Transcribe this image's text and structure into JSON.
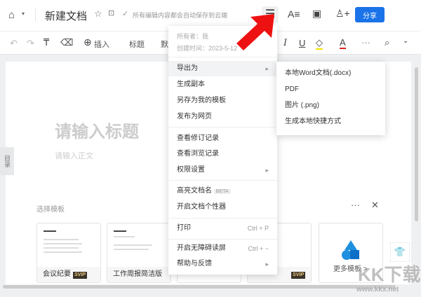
{
  "header": {
    "title": "新建文档",
    "save_status": "所有编辑内容都会自动保存到云端",
    "share": "分享"
  },
  "toolbar": {
    "insert": "插入",
    "heading": "标题",
    "font_partial": "默"
  },
  "doc": {
    "title_placeholder": "请输入标题",
    "body_placeholder": "请输入正文",
    "toc": "目录"
  },
  "templates": {
    "label": "选择模板",
    "items": [
      {
        "name": "会议纪要",
        "badge": "SVIP"
      },
      {
        "name": "工作周报简洁版"
      },
      {
        "name": "",
        "hidden": true
      },
      {
        "name": "",
        "badge": "SVIP"
      },
      {
        "name": "更多模板 >"
      }
    ]
  },
  "menu": {
    "owner": "所有者：我",
    "created": "创建时间：2023-5-12",
    "items": [
      "导出为",
      "生成副本",
      "另存为我的模板",
      "发布为网页",
      "查看修订记录",
      "查看浏览记录",
      "权限设置",
      "高亮文档名",
      "开启文档个性器",
      "打印",
      "开启无障碍读屏",
      "帮助与反馈"
    ],
    "beta": "BETA",
    "print_shortcut": "Ctrl + P",
    "a11y_shortcut": "Ctrl + ~"
  },
  "submenu": {
    "items": [
      "本地Word文档(.docx)",
      "PDF",
      "图片 (.png)",
      "生成本地快捷方式"
    ]
  },
  "watermark": {
    "text": "KK下载",
    "url": "www.kkx.net"
  },
  "colors": {
    "accent": "#1a73e8",
    "arrow": "#ee1111"
  }
}
